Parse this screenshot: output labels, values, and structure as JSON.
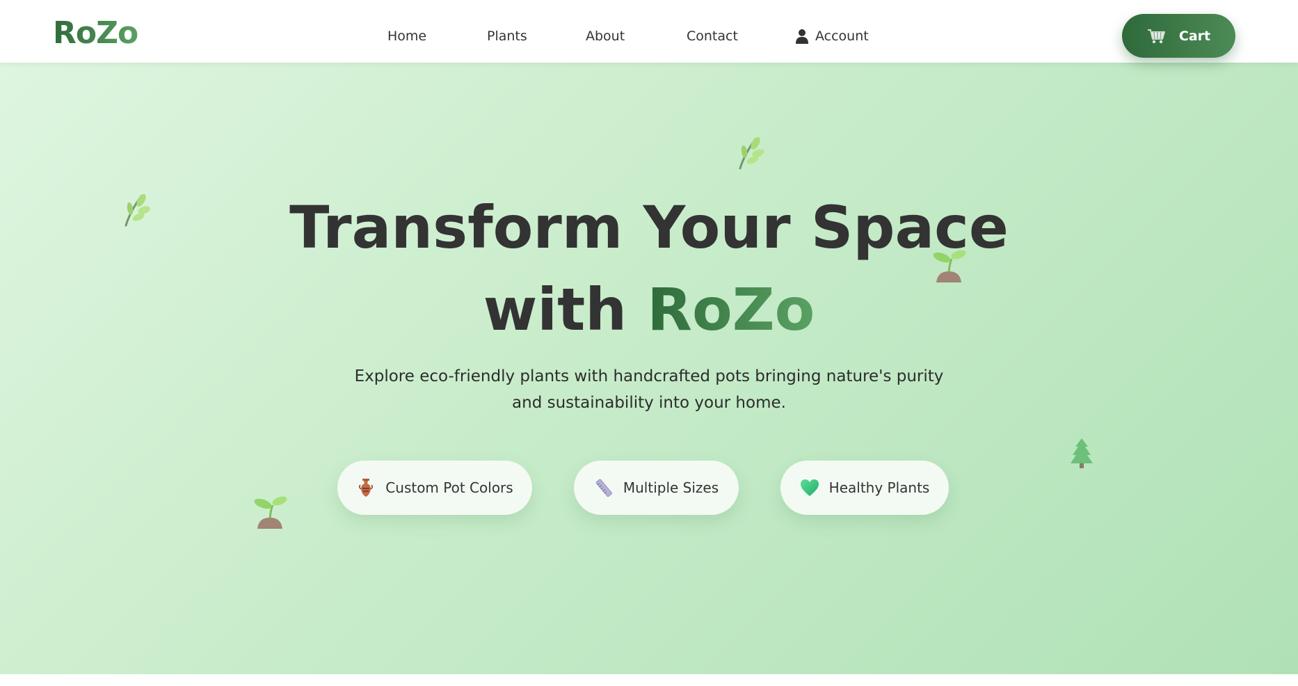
{
  "header": {
    "logo": "RoZo",
    "nav": [
      {
        "label": "Home"
      },
      {
        "label": "Plants"
      },
      {
        "label": "About"
      },
      {
        "label": "Contact"
      },
      {
        "label": "Account",
        "icon": "user-icon"
      }
    ],
    "cart": {
      "label": "Cart",
      "icon": "cart-icon"
    }
  },
  "hero": {
    "title_line1": "Transform Your Space",
    "title_line2_prefix": "with",
    "title_line2_brand": "RoZo",
    "subtitle_line1": "Explore eco-friendly plants with handcrafted pots bringing nature's purity",
    "subtitle_line2": "and sustainability into your home.",
    "features": [
      {
        "label": "Custom Pot Colors",
        "icon": "vase-icon"
      },
      {
        "label": "Multiple Sizes",
        "icon": "ruler-icon"
      },
      {
        "label": "Healthy Plants",
        "icon": "green-heart-icon"
      }
    ],
    "decorations": [
      "herb-icon",
      "herb-icon",
      "seedling-icon",
      "seedling-icon",
      "evergreen-tree-icon"
    ]
  },
  "colors": {
    "brand_dark": "#2f6b3a",
    "brand_light": "#5aa163",
    "hero_bg_start": "#def5e0",
    "hero_bg_end": "#b0e1b6",
    "text": "#333333"
  }
}
